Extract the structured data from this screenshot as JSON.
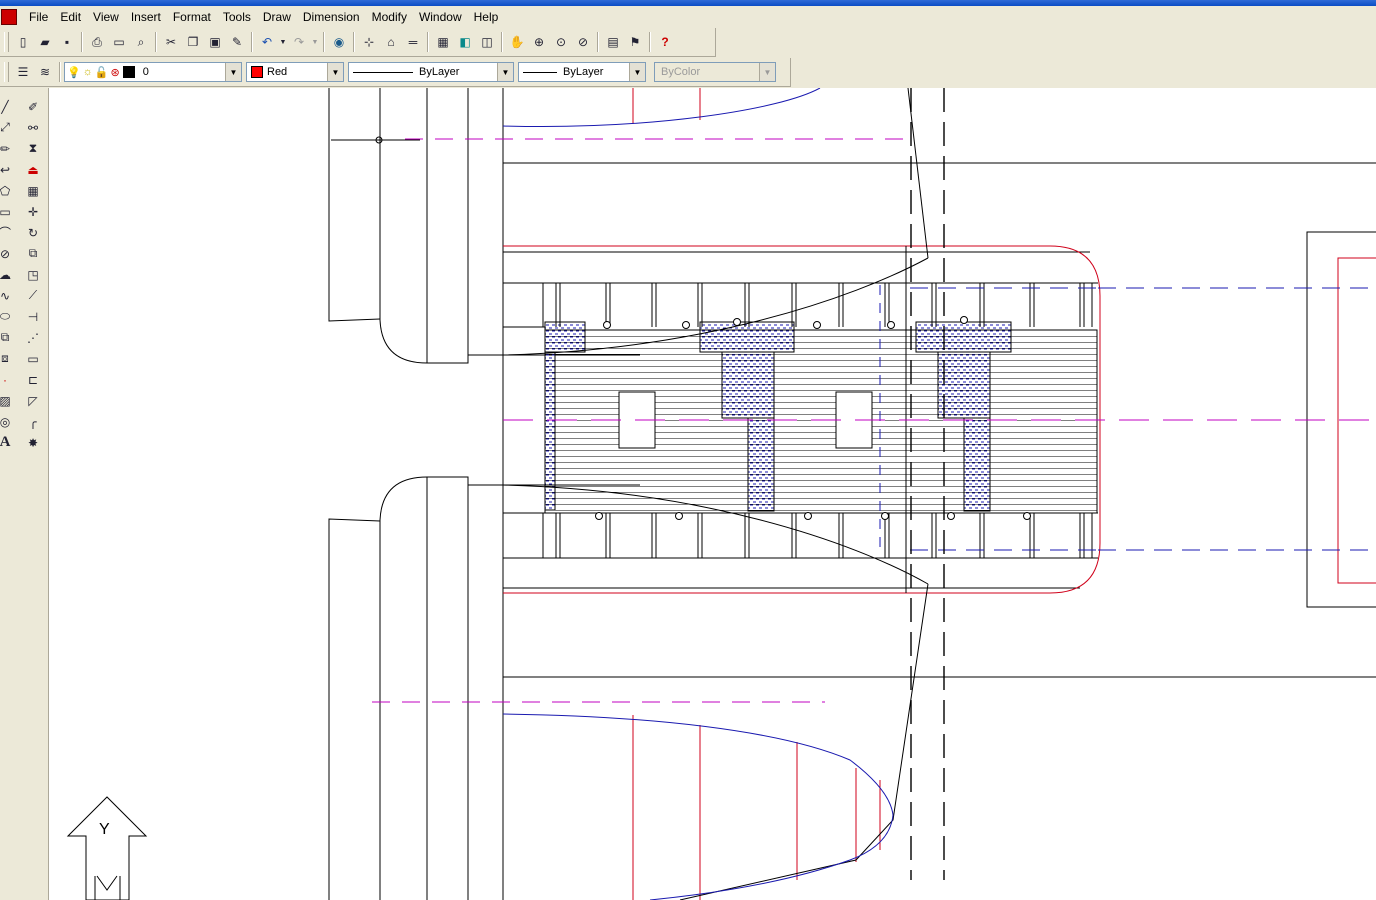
{
  "menu": [
    "File",
    "Edit",
    "View",
    "Insert",
    "Format",
    "Tools",
    "Draw",
    "Dimension",
    "Modify",
    "Window",
    "Help"
  ],
  "toolbar_standard": [
    "new-icon",
    "open-icon",
    "save-icon",
    "|",
    "print-icon",
    "preview-icon",
    "find-icon",
    "|",
    "cut-icon",
    "copy-icon",
    "paste-icon",
    "match-properties-icon",
    "|",
    "undo-icon",
    "undo-dropdown-icon",
    "redo-icon",
    "redo-dropdown-icon",
    "|",
    "web-icon",
    "|",
    "snap-icon",
    "point-filter-icon",
    "ucs-icon",
    "|",
    "named-views-icon",
    "3d-views-icon",
    "|",
    "pan-icon",
    "zoom-realtime-icon",
    "zoom-window-icon",
    "zoom-previous-icon",
    "|",
    "properties-icon",
    "design-center-icon",
    "|",
    "help-icon"
  ],
  "layer": {
    "name": "0"
  },
  "color_control": {
    "value": "Red",
    "swatch": "#FF0000"
  },
  "linetype_control": {
    "value": "ByLayer"
  },
  "lineweight_control": {
    "value": "ByLayer"
  },
  "plotstyle_control": {
    "value": "ByColor"
  },
  "draw_tools": [
    "line-icon",
    "construction-line-icon",
    "polyline-icon",
    "polygon-icon",
    "rectangle-icon",
    "arc-icon",
    "circle-icon",
    "revision-cloud-icon",
    "spline-icon",
    "ellipse-icon",
    "insert-block-icon",
    "make-block-icon",
    "point-icon",
    "hatch-icon",
    "region-icon",
    "multiline-text-icon"
  ],
  "modify_tools": [
    "erase-icon",
    "copy-object-icon",
    "mirror-icon",
    "offset-icon",
    "array-icon",
    "move-icon",
    "rotate-icon",
    "scale-icon",
    "stretch-icon",
    "trim-icon",
    "extend-icon",
    "break-icon",
    "join-icon",
    "chamfer-icon",
    "fillet-icon",
    "explode-icon"
  ],
  "ucs_label": "Y",
  "colors": {
    "red": "#D0021B",
    "blue": "#1A1AB0",
    "magenta": "#C000C0",
    "black": "#000000"
  }
}
